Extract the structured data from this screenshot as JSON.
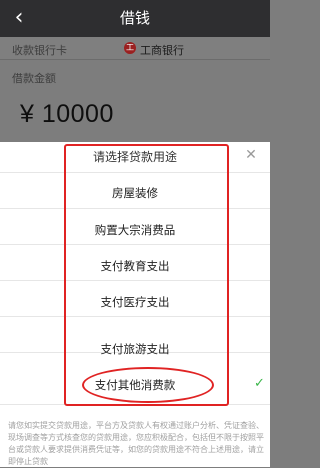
{
  "header": {
    "title": "借钱",
    "back_icon": "chevron-left-icon"
  },
  "bank_row": {
    "label": "收款银行卡",
    "bank_name": "工商银行",
    "bank_logo_char": "工"
  },
  "amount_row": {
    "label": "借款金额",
    "value": "¥ 10000"
  },
  "sheet": {
    "title": "请选择贷款用途",
    "close_icon": "close-icon",
    "options": [
      "房屋装修",
      "购置大宗消费品",
      "支付教育支出",
      "支付医疗支出",
      "支付旅游支出",
      "支付其他消费款"
    ],
    "selected_index": 5,
    "note": "请您如实提交贷款用途，平台方及贷款人有权通过账户分析、凭证查验、现场调查等方式核查您的贷款用途，您应积极配合，包括但不限于按照平台或贷款人要求提供消费凭证等，如您的贷款用途不符合上述用途，请立即停止贷款"
  },
  "colors": {
    "highlight": "#e02323",
    "check": "#3bb64a",
    "header_bg": "#2e2e30"
  }
}
